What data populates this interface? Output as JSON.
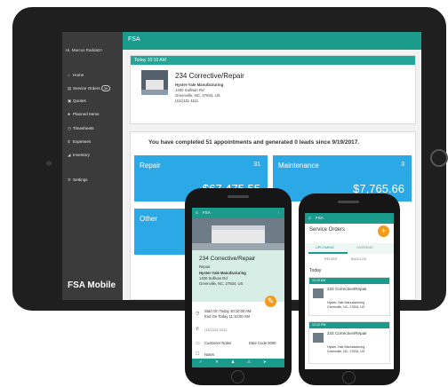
{
  "tablet": {
    "app_title": "FSA",
    "greeting": "Hi, Marcus Raddatz!",
    "nav": [
      {
        "icon": "home-icon",
        "glyph": "⌂",
        "label": "Home"
      },
      {
        "icon": "wrench-icon",
        "glyph": "▤",
        "label": "Service Orders",
        "badge": "39"
      },
      {
        "icon": "quote-icon",
        "glyph": "▣",
        "label": "Quotes"
      },
      {
        "icon": "planned-items-icon",
        "glyph": "♣",
        "label": "Planned Items"
      },
      {
        "icon": "clock-icon",
        "glyph": "◷",
        "label": "Timesheets"
      },
      {
        "icon": "dollar-icon",
        "glyph": "$",
        "label": "Expenses"
      },
      {
        "icon": "inventory-icon",
        "glyph": "◢",
        "label": "Inventory"
      },
      {
        "icon": "gear-icon",
        "glyph": "✲",
        "label": "Settings"
      }
    ],
    "brand": "FSA Mobile",
    "appointment": {
      "header": "Today 10:10 AM",
      "title": "234 Corrective/Repair",
      "company": "Hyster-Yale Manufacturing",
      "address1": "1400 Sullivan Rd",
      "address2": "Greenville, NC, 27834, US",
      "phone": "(111)111-1111"
    },
    "summary": "You have completed 51 appointments and generated 0 leads since 9/19/2017.",
    "tiles": [
      {
        "label": "Repair",
        "count": "31",
        "amount": "$67,475.55"
      },
      {
        "label": "Maintenance",
        "count": "3",
        "amount": "$7,765.66"
      },
      {
        "label": "Other",
        "count": "",
        "amount": ""
      }
    ],
    "accent": "#1b9b8c",
    "tile_color": "#2ba8e6"
  },
  "phone1": {
    "app_title": "FSA",
    "title": "234 Corrective/Repair",
    "subtitle": "Repair",
    "company": "Hyster-Yale Manufacturing",
    "address1": "1400 Sullivan Rd",
    "address2": "Greenville, NC, 27834, US",
    "start": "Start On Today 10:10:00 AM",
    "end": "End On Today 11:10:00 AM",
    "phone": "(111)111-1111",
    "customer_notes": "Customer Notes",
    "date_code": "Date Code 0000",
    "notes": "Notes"
  },
  "phone2": {
    "app_title": "FSA",
    "header": "Service Orders",
    "tabs": [
      "UPCOMING",
      "OVERDUE"
    ],
    "subtabs": [
      "RECENT",
      "BACKLOG"
    ],
    "section": "Today",
    "items": [
      {
        "time": "10:10 AM",
        "title": "234 Corrective/Repair",
        "company": "Hyster-Yale Manufacturing",
        "address": "Greenville, NC, 27834, US"
      },
      {
        "time": "12:10 PM",
        "title": "234 Corrective/Repair",
        "company": "Hyster-Yale Manufacturing",
        "address": "Greenville, NC, 27834, US"
      }
    ]
  }
}
